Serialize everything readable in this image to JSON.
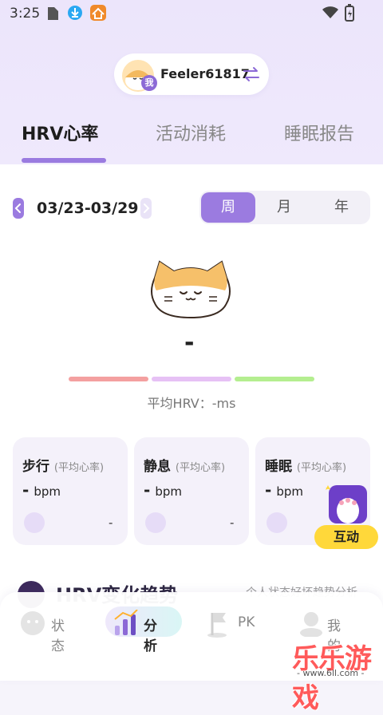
{
  "status_bar": {
    "time": "3:25"
  },
  "user": {
    "name": "Feeler61817",
    "badge": "我"
  },
  "tabs": [
    {
      "label": "HRV心率",
      "active": true
    },
    {
      "label": "活动消耗",
      "active": false
    },
    {
      "label": "睡眠报告",
      "active": false
    }
  ],
  "date_range": "03/23-03/29",
  "period_options": [
    {
      "label": "周",
      "active": true
    },
    {
      "label": "月",
      "active": false
    },
    {
      "label": "年",
      "active": false
    }
  ],
  "main_value": "-",
  "avg_hrv_text": "平均HRV：-ms",
  "range_colors": [
    "#f4a0a0",
    "#e6c1f5",
    "#b4ee90"
  ],
  "stat_cards": [
    {
      "title": "步行",
      "subtitle": "(平均心率)",
      "value": "-",
      "unit": "bpm",
      "trend": "-"
    },
    {
      "title": "静息",
      "subtitle": "(平均心率)",
      "value": "-",
      "unit": "bpm",
      "trend": "-"
    },
    {
      "title": "睡眠",
      "subtitle": "(平均心率)",
      "value": "-",
      "unit": "bpm",
      "trend": ""
    }
  ],
  "interact_button": "互动",
  "section": {
    "title": "HRV变化趋势",
    "right_text": "个人状态好坏趋势分析"
  },
  "nav": [
    {
      "label": "状态",
      "icon": "ghost-status-icon",
      "active": false
    },
    {
      "label": "分析",
      "icon": "analysis-bars-icon",
      "active": true
    },
    {
      "label": "PK",
      "icon": "flag-pk-icon",
      "active": false
    },
    {
      "label": "我的",
      "icon": "profile-icon",
      "active": false
    }
  ],
  "watermark": {
    "text": "乐乐游戏",
    "url": "- www.6ll.com -"
  },
  "colors": {
    "accent": "#9b7be0",
    "interact": "#ffd83a"
  }
}
